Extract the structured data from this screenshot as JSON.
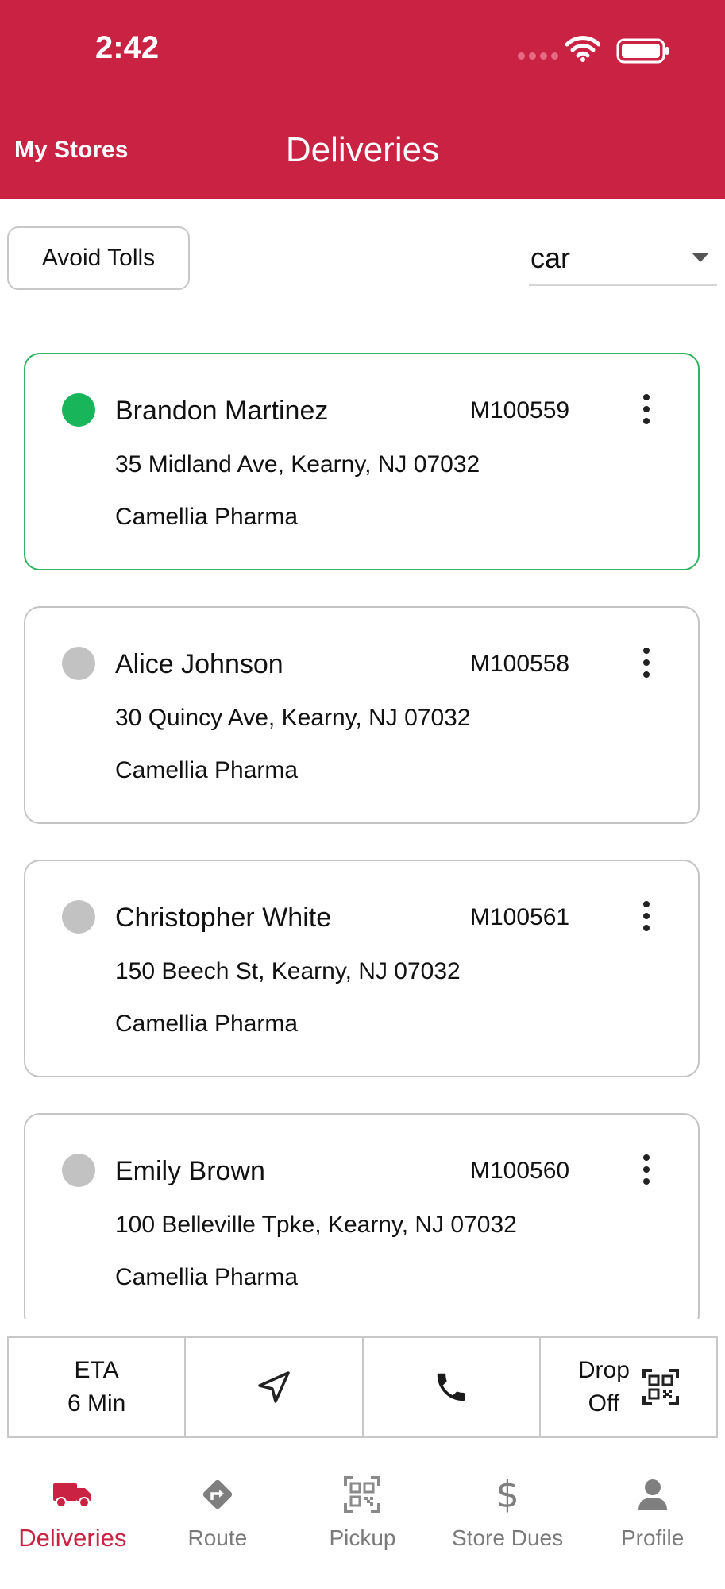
{
  "status_bar": {
    "time": "2:42"
  },
  "header": {
    "left_link": "My Stores",
    "title": "Deliveries"
  },
  "controls": {
    "avoid_tolls_label": "Avoid Tolls",
    "travel_mode": "car"
  },
  "deliveries": [
    {
      "name": "Brandon Martinez",
      "order_id": "M100559",
      "address": "35 Midland Ave, Kearny, NJ 07032",
      "store": "Camellia Pharma",
      "status": "active"
    },
    {
      "name": "Alice Johnson",
      "order_id": "M100558",
      "address": "30 Quincy Ave, Kearny, NJ 07032",
      "store": "Camellia Pharma",
      "status": "pending"
    },
    {
      "name": "Christopher White",
      "order_id": "M100561",
      "address": "150 Beech St, Kearny, NJ 07032",
      "store": "Camellia Pharma",
      "status": "pending"
    },
    {
      "name": "Emily Brown",
      "order_id": "M100560",
      "address": "100 Belleville Tpke, Kearny, NJ 07032",
      "store": "Camellia Pharma",
      "status": "pending"
    }
  ],
  "action_bar": {
    "eta_label": "ETA",
    "eta_value": "6 Min",
    "navigate_icon": "navigation-arrow-icon",
    "call_icon": "phone-icon",
    "drop_off_line1": "Drop",
    "drop_off_line2": "Off",
    "drop_off_icon": "qr-code-icon"
  },
  "bottom_nav": {
    "items": [
      {
        "label": "Deliveries",
        "icon": "truck-icon",
        "active": true
      },
      {
        "label": "Route",
        "icon": "directions-icon",
        "active": false
      },
      {
        "label": "Pickup",
        "icon": "qr-scan-icon",
        "active": false
      },
      {
        "label": "Store Dues",
        "icon": "dollar-icon",
        "active": false
      },
      {
        "label": "Profile",
        "icon": "person-icon",
        "active": false
      }
    ]
  },
  "colors": {
    "brand": "#c92242",
    "active_status": "#19b55a",
    "active_border": "#2fb35e",
    "inactive_status": "#c2c2c2"
  }
}
